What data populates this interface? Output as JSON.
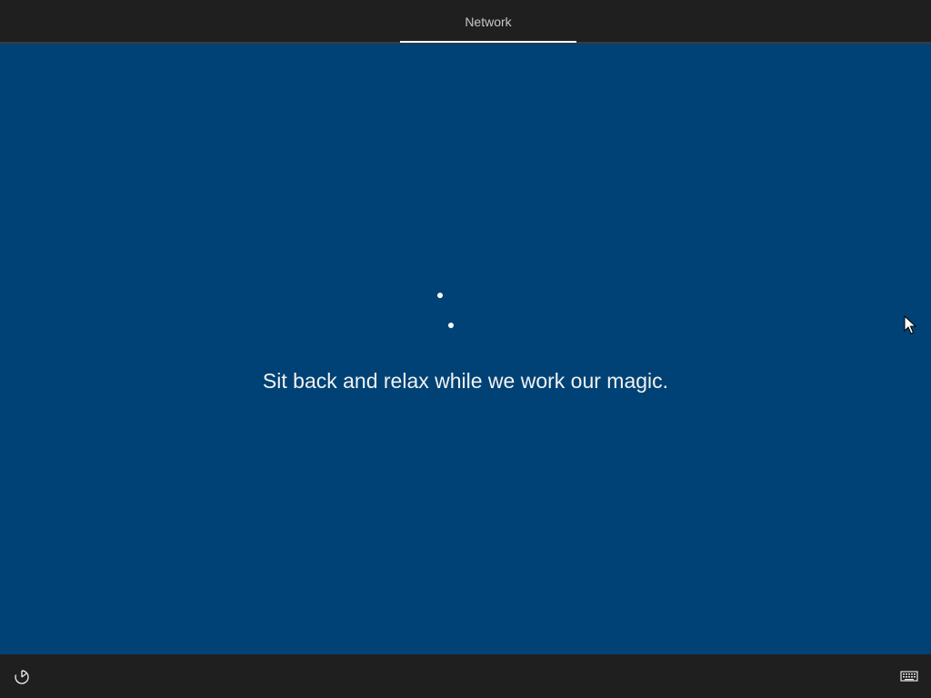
{
  "header": {
    "active_tab": "Network"
  },
  "main": {
    "message": "Sit back and relax while we work our magic."
  },
  "footer": {
    "left_icon": "ease-of-access-icon",
    "right_icon": "keyboard-icon"
  },
  "colors": {
    "background": "#004275",
    "bar": "#1f1f1f",
    "text": "#f2f2f2"
  }
}
